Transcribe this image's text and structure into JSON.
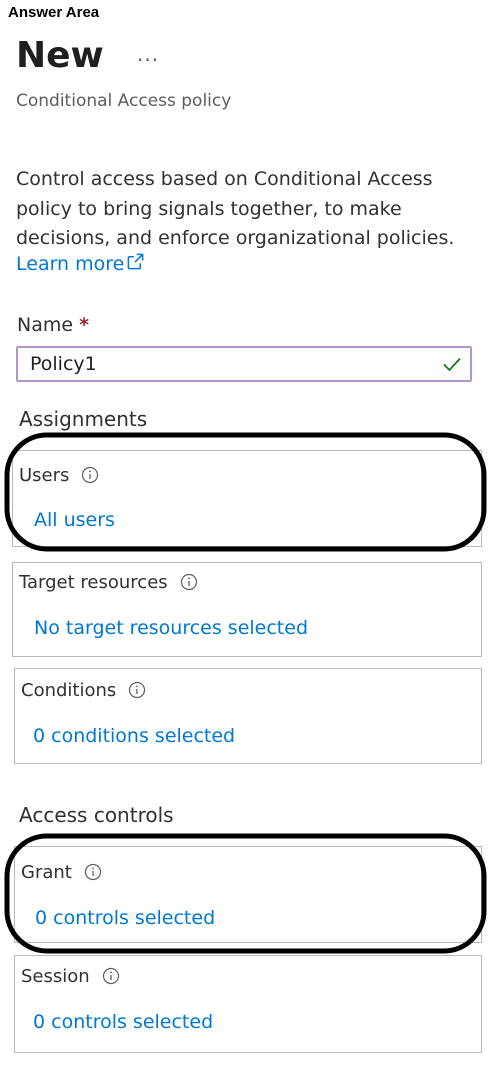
{
  "answer_area_label": "Answer Area",
  "page": {
    "title": "New",
    "more_icon": "···",
    "subtitle": "Conditional Access policy"
  },
  "description": "Control access based on Conditional Access policy to bring signals together, to make decisions, and enforce organizational policies.",
  "learn_more_label": "Learn more",
  "name_field": {
    "label": "Name",
    "required_mark": "*",
    "value": "Policy1"
  },
  "assignments": {
    "title": "Assignments",
    "users": {
      "title": "Users",
      "value": "All users"
    },
    "target_resources": {
      "title": "Target resources",
      "value": "No target resources selected"
    },
    "conditions": {
      "title": "Conditions",
      "value": "0 conditions selected"
    }
  },
  "access_controls": {
    "title": "Access controls",
    "grant": {
      "title": "Grant",
      "value": "0 controls selected"
    },
    "session": {
      "title": "Session",
      "value": "0 controls selected"
    }
  },
  "icons": {
    "more": "more-horizontal-icon",
    "external_link": "external-link-icon",
    "check": "checkmark-icon",
    "info": "info-icon"
  },
  "colors": {
    "link": "#0078d4",
    "input_border": "#b296c8",
    "check": "#107c10",
    "required": "#a4262c"
  }
}
